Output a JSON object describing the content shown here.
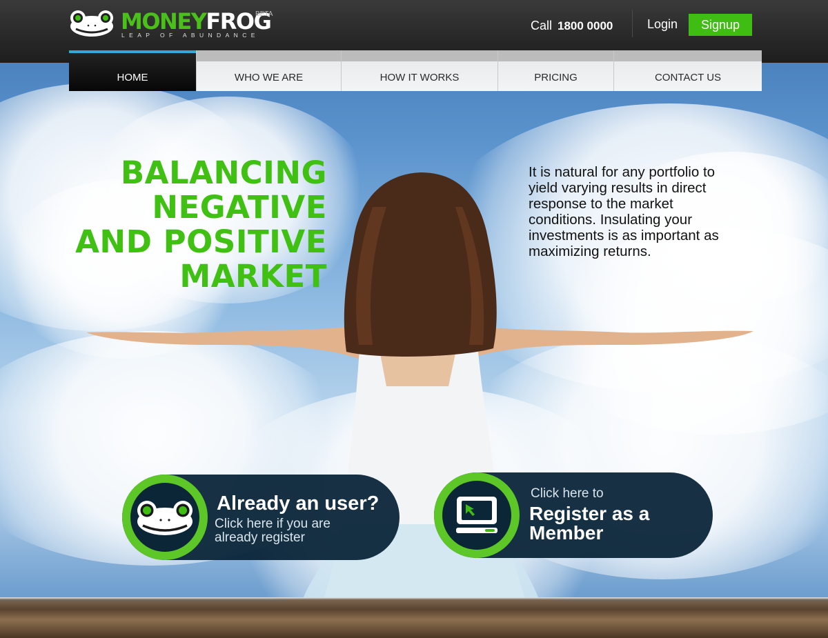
{
  "brand": {
    "name_part1": "MONEY",
    "name_part2": "FROG",
    "beta": "BETA",
    "tagline": "LEAP OF ABUNDANCE",
    "accent_color": "#3fbd12"
  },
  "header": {
    "call_label": "Call",
    "phone": "1800 0000",
    "login_label": "Login",
    "signup_label": "Signup"
  },
  "nav": {
    "items": [
      {
        "label": "HOME",
        "active": true
      },
      {
        "label": "WHO WE ARE",
        "active": false
      },
      {
        "label": "HOW IT WORKS",
        "active": false
      },
      {
        "label": "PRICING",
        "active": false
      },
      {
        "label": "CONTACT US",
        "active": false
      }
    ]
  },
  "hero": {
    "headline_lines": [
      "BALANCING",
      "NEGATIVE",
      "AND POSITIVE",
      "MARKET"
    ],
    "intro": "It is natural for any portfolio to yield varying results in direct response to the market conditions. Insulating your investments is as important as maximizing returns."
  },
  "cta": {
    "existing_user": {
      "title": "Already an user?",
      "subtitle": "Click here if you are already register",
      "icon": "frog-icon"
    },
    "register": {
      "prefix": "Click here to",
      "title": "Register as a Member",
      "icon": "computer-icon"
    }
  }
}
